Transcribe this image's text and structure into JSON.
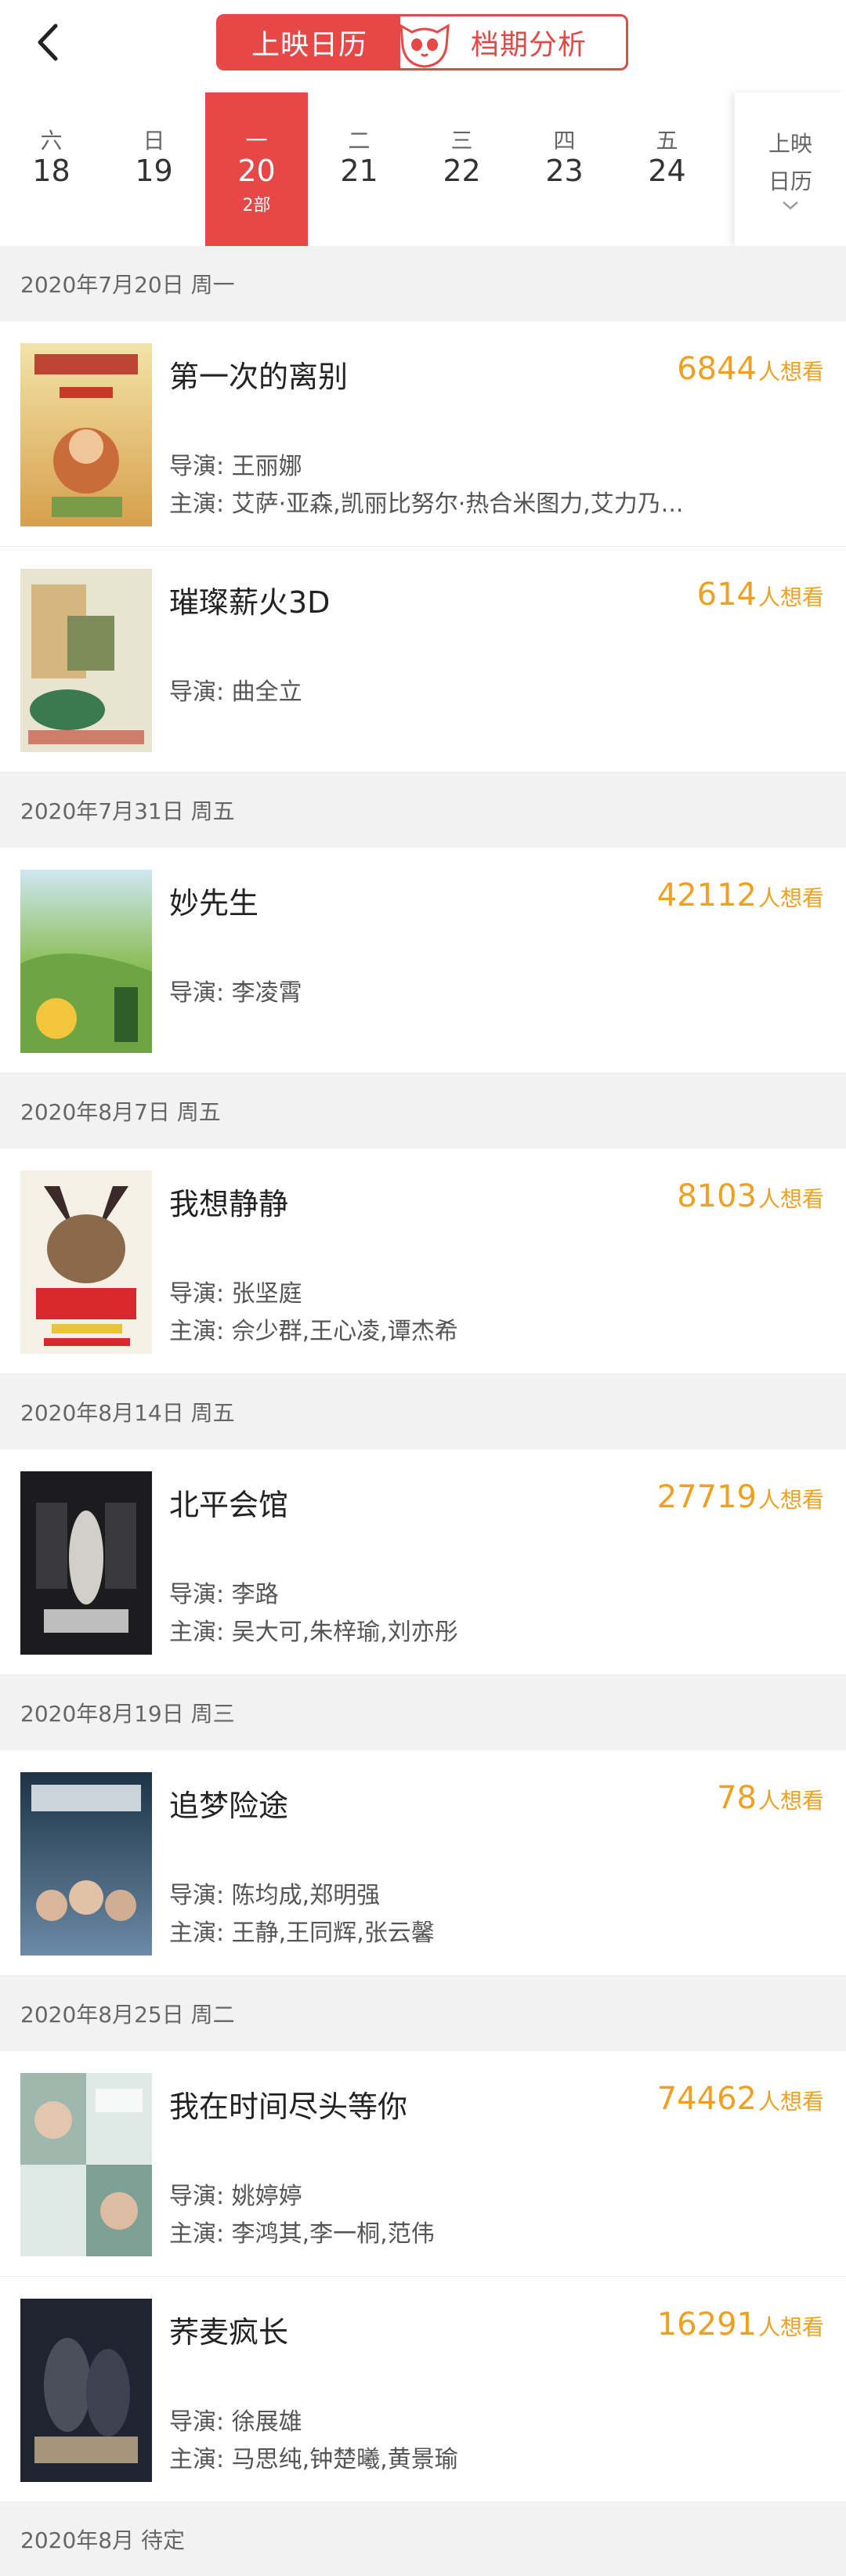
{
  "header": {
    "tab_calendar": "上映日历",
    "tab_analysis": "档期分析"
  },
  "colors": {
    "accent": "#e54847",
    "wish": "#f0a021"
  },
  "datebar": {
    "days": [
      {
        "weekday": "六",
        "date": "18"
      },
      {
        "weekday": "日",
        "date": "19"
      },
      {
        "weekday": "一",
        "date": "20",
        "count": "2部",
        "selected": true
      },
      {
        "weekday": "二",
        "date": "21"
      },
      {
        "weekday": "三",
        "date": "22"
      },
      {
        "weekday": "四",
        "date": "23"
      },
      {
        "weekday": "五",
        "date": "24"
      }
    ],
    "calendar_button": {
      "line1": "上映",
      "line2": "日历"
    }
  },
  "sections": [
    {
      "date": "2020年7月20日 周一",
      "movies": [
        {
          "title": "第一次的离别",
          "wish_count": "6844",
          "wish_label": "人想看",
          "director": "导演: 王丽娜",
          "cast": "主演: 艾萨·亚森,凯丽比努尔·热合米图力,艾力乃..."
        },
        {
          "title": "璀璨薪火3D",
          "wish_count": "614",
          "wish_label": "人想看",
          "director": "导演: 曲全立",
          "cast": ""
        }
      ]
    },
    {
      "date": "2020年7月31日 周五",
      "movies": [
        {
          "title": "妙先生",
          "wish_count": "42112",
          "wish_label": "人想看",
          "director": "导演: 李凌霄",
          "cast": ""
        }
      ]
    },
    {
      "date": "2020年8月7日 周五",
      "movies": [
        {
          "title": "我想静静",
          "wish_count": "8103",
          "wish_label": "人想看",
          "director": "导演: 张坚庭",
          "cast": "主演: 佘少群,王心凌,谭杰希"
        }
      ]
    },
    {
      "date": "2020年8月14日 周五",
      "movies": [
        {
          "title": "北平会馆",
          "wish_count": "27719",
          "wish_label": "人想看",
          "director": "导演: 李路",
          "cast": "主演: 吴大可,朱梓瑜,刘亦彤"
        }
      ]
    },
    {
      "date": "2020年8月19日 周三",
      "movies": [
        {
          "title": "追梦险途",
          "wish_count": "78",
          "wish_label": "人想看",
          "director": "导演: 陈均成,郑明强",
          "cast": "主演: 王静,王同辉,张云馨"
        }
      ]
    },
    {
      "date": "2020年8月25日 周二",
      "movies": [
        {
          "title": "我在时间尽头等你",
          "wish_count": "74462",
          "wish_label": "人想看",
          "director": "导演: 姚婷婷",
          "cast": "主演: 李鸿其,李一桐,范伟"
        },
        {
          "title": "荞麦疯长",
          "wish_count": "16291",
          "wish_label": "人想看",
          "director": "导演: 徐展雄",
          "cast": "主演: 马思纯,钟楚曦,黄景瑜"
        }
      ]
    },
    {
      "date": "2020年8月 待定",
      "movies": []
    }
  ]
}
